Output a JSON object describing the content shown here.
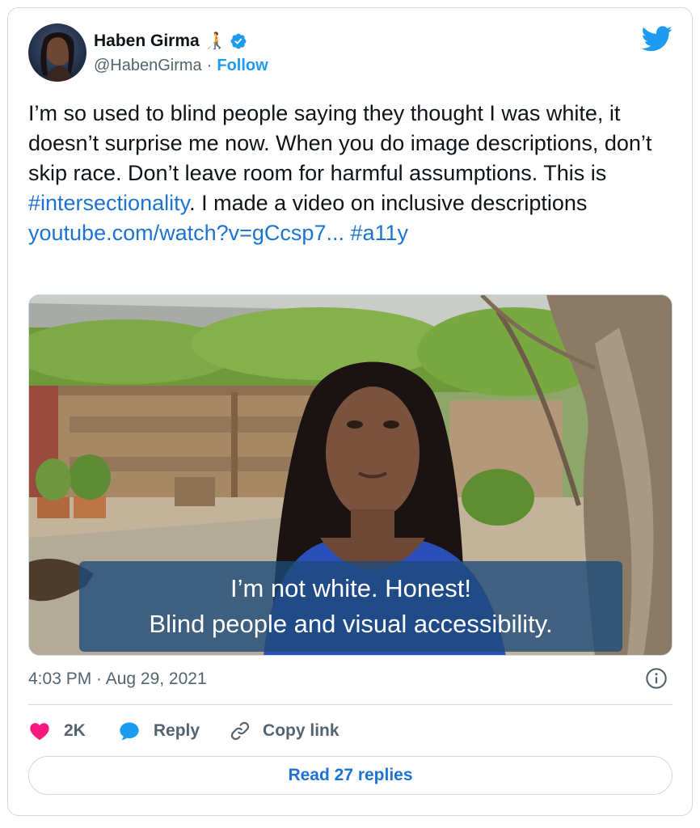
{
  "author": {
    "name": "Haben Girma",
    "name_emoji": "🧑‍🦯",
    "handle": "@HabenGirma",
    "separator": "·",
    "follow_label": "Follow"
  },
  "tweet": {
    "text_part1": "I’m so used to blind people saying they thought I was white, it doesn’t surprise me now. When you do image descriptions, don’t skip race. Don’t leave room for harmful assumptions. This is ",
    "hashtag1": "#intersectionality",
    "text_part2": ". I made a video on inclusive descriptions",
    "link": "youtube.com/watch?v=gCcsp7...",
    "hashtag2": "#a11y"
  },
  "media": {
    "caption_line1": "I’m not white. Honest!",
    "caption_line2": "Blind people and visual accessibility."
  },
  "timestamp": "4:03 PM · Aug 29, 2021",
  "actions": {
    "like_count": "2K",
    "reply_label": "Reply",
    "copy_link_label": "Copy link"
  },
  "read_replies_label": "Read 27 replies",
  "colors": {
    "accent": "#1d9bf0",
    "link": "#1d73d3",
    "like": "#f91880",
    "muted": "#536471",
    "border": "#cfd9de"
  },
  "icons": [
    "bird-icon",
    "verified-icon",
    "info-icon",
    "heart-icon",
    "reply-icon",
    "link-icon"
  ]
}
